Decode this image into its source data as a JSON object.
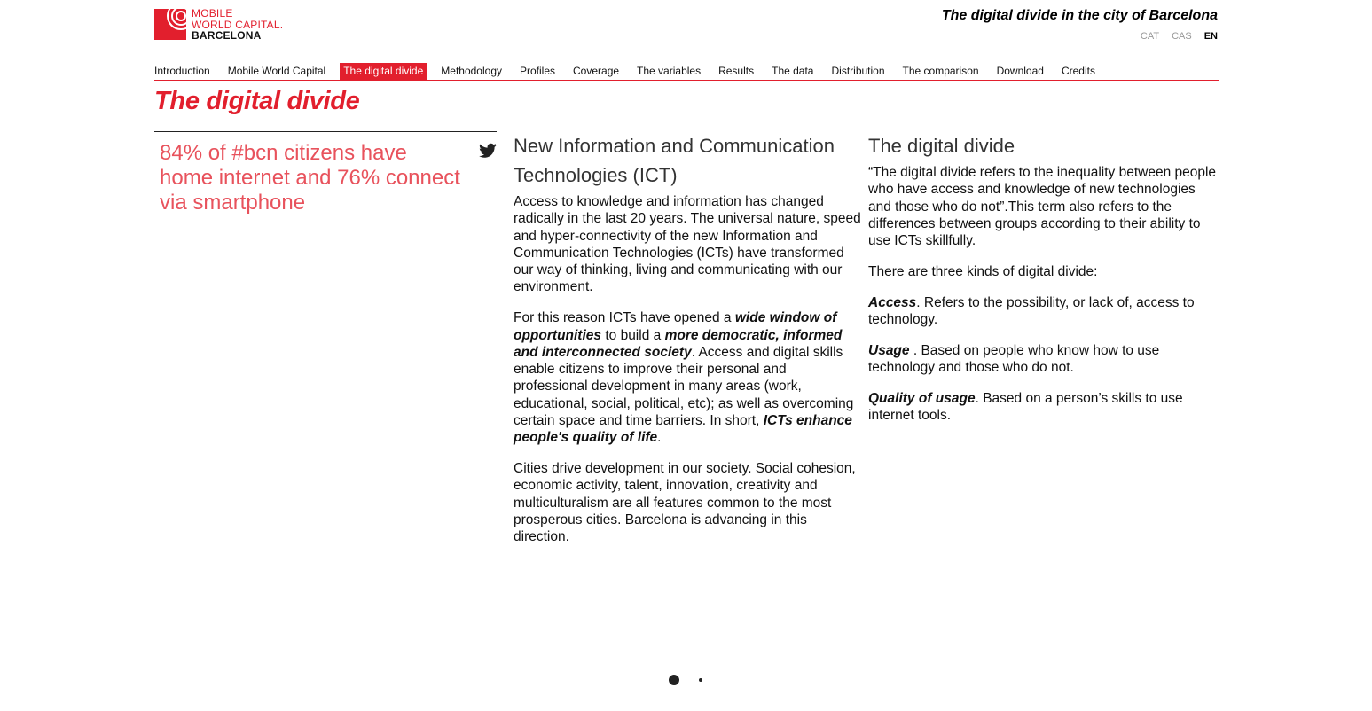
{
  "logo": {
    "line1": "MOBILE",
    "line2": "WORLD CAPITAL.",
    "line3": "BARCELONA"
  },
  "header": {
    "site_title": "The digital divide in the city of Barcelona",
    "languages": [
      "CAT",
      "CAS",
      "EN"
    ],
    "active_language": "EN"
  },
  "nav": {
    "items": [
      "Introduction",
      "Mobile World Capital",
      "The digital divide",
      "Methodology",
      "Profiles",
      "Coverage",
      "The variables",
      "Results",
      "The data",
      "Distribution",
      "The comparison",
      "Download",
      "Credits"
    ],
    "active": "The digital divide"
  },
  "page": {
    "title": "The digital divide"
  },
  "quote": {
    "text": "84% of #bcn citizens have home internet and 76% connect via smartphone",
    "icon": "twitter-icon"
  },
  "ict": {
    "heading": "New Information and Communication Technologies (ICT)",
    "p1": "Access to knowledge and information has changed radically in the last 20 years. The universal nature, speed and hyper-connectivity of the new Information and Communication Technologies (ICTs) have transformed our way of thinking, living and communicating with our environment.",
    "p2_a": "For this reason ICTs have opened a ",
    "p2_b": "wide window of opportunities",
    "p2_c": " to build a ",
    "p2_d": "more democratic, informed and interconnected society",
    "p2_e": ". Access and digital skills enable citizens to improve their personal and professional development in many areas (work, educational, social, political, etc); as well as overcoming certain space and time barriers. In short, ",
    "p2_f": "ICTs enhance people's quality of life",
    "p2_g": ".",
    "p3": "Cities drive development in our society. Social cohesion, economic activity, talent, innovation, creativity and multiculturalism are all features common to the most prosperous cities. Barcelona is advancing in this direction."
  },
  "divide": {
    "heading": "The digital divide",
    "p1": "“The digital divide refers to the inequality between people who have access and knowledge of new technologies and those who do not”.This term also refers to the differences between groups according to their ability to use ICTs skillfully.",
    "p2": "There are three kinds of digital divide:",
    "access_term": "Access",
    "access_text": ". Refers to the possibility, or lack of, access to technology.",
    "usage_term": "Usage",
    "usage_text": " . Based on people who know how to use technology and those who do not.",
    "quality_term": "Quality of usage",
    "quality_text": ". Based on a person’s skills to use internet tools."
  },
  "pager": {
    "pages": 2,
    "current": 1
  }
}
